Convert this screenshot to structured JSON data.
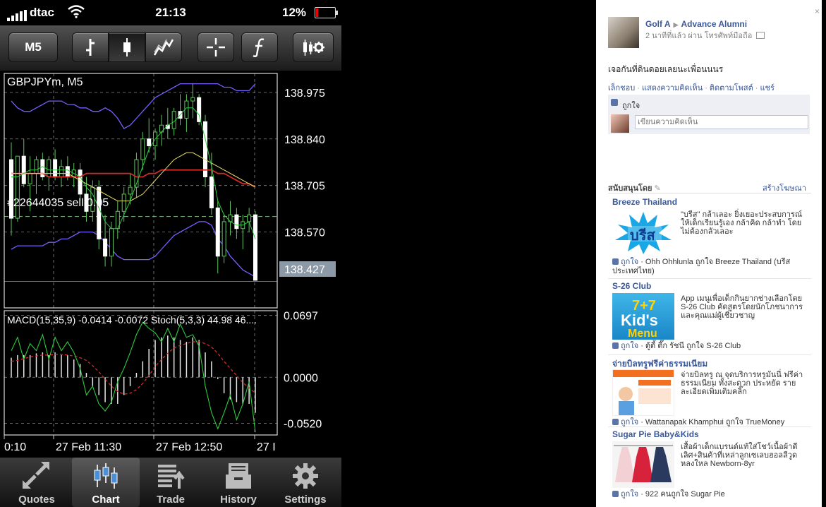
{
  "status": {
    "carrier": "dtac",
    "time": "21:13",
    "battery": "12%"
  },
  "toolbar": {
    "timeframe": "M5"
  },
  "chart": {
    "symbol_label": "GBPJPYm, M5",
    "order_label": "#22644035 sell 0.05",
    "indicator_label": "MACD(15,35,9) -0.0414 -0.0072 Stoch(5,3,3) 44.98 46....",
    "price_ticks": [
      "138.975",
      "138.840",
      "138.705",
      "138.570"
    ],
    "current_price": "138.427",
    "macd_ticks": [
      "0.0697",
      "0.0000",
      "-0.0520"
    ],
    "time_ticks": [
      "0:10",
      "27 Feb 11:30",
      "27 Feb 12:50",
      "27 I"
    ]
  },
  "chart_data": {
    "type": "candlestick",
    "price_ylim": [
      138.35,
      139.03
    ],
    "candles": [
      [
        138.78,
        138.83,
        138.56,
        138.61
      ],
      [
        138.61,
        138.79,
        138.6,
        138.79
      ],
      [
        138.79,
        138.84,
        138.7,
        138.71
      ],
      [
        138.71,
        138.79,
        138.63,
        138.74
      ],
      [
        138.74,
        138.79,
        138.68,
        138.78
      ],
      [
        138.78,
        138.8,
        138.72,
        138.73
      ],
      [
        138.73,
        138.79,
        138.69,
        138.78
      ],
      [
        138.78,
        138.81,
        138.72,
        138.73
      ],
      [
        138.73,
        138.78,
        138.7,
        138.76
      ],
      [
        138.76,
        138.79,
        138.72,
        138.73
      ],
      [
        138.73,
        138.77,
        138.7,
        138.75
      ],
      [
        138.75,
        138.77,
        138.66,
        138.68
      ],
      [
        138.68,
        138.73,
        138.6,
        138.63
      ],
      [
        138.63,
        138.72,
        138.6,
        138.7
      ],
      [
        138.7,
        138.72,
        138.52,
        138.55
      ],
      [
        138.55,
        138.62,
        138.47,
        138.5
      ],
      [
        138.5,
        138.6,
        138.47,
        138.58
      ],
      [
        138.58,
        138.66,
        138.55,
        138.63
      ],
      [
        138.63,
        138.7,
        138.6,
        138.68
      ],
      [
        138.68,
        138.74,
        138.65,
        138.7
      ],
      [
        138.7,
        138.8,
        138.67,
        138.78
      ],
      [
        138.78,
        138.86,
        138.75,
        138.84
      ],
      [
        138.84,
        138.9,
        138.8,
        138.82
      ],
      [
        138.82,
        138.87,
        138.78,
        138.86
      ],
      [
        138.86,
        138.91,
        138.82,
        138.88
      ],
      [
        138.88,
        138.93,
        138.84,
        138.87
      ],
      [
        138.87,
        138.93,
        138.85,
        138.92
      ],
      [
        138.92,
        138.97,
        138.88,
        138.9
      ],
      [
        138.9,
        138.97,
        138.86,
        138.95
      ],
      [
        138.95,
        139.0,
        138.9,
        138.96
      ],
      [
        138.96,
        138.97,
        138.88,
        138.89
      ],
      [
        138.89,
        138.91,
        138.7,
        138.73
      ],
      [
        138.73,
        138.8,
        138.62,
        138.64
      ],
      [
        138.64,
        138.66,
        138.45,
        138.5
      ],
      [
        138.5,
        138.62,
        138.48,
        138.6
      ],
      [
        138.6,
        138.66,
        138.56,
        138.62
      ],
      [
        138.62,
        138.64,
        138.55,
        138.58
      ],
      [
        138.58,
        138.62,
        138.52,
        138.6
      ],
      [
        138.6,
        138.64,
        138.57,
        138.62
      ],
      [
        138.62,
        138.63,
        138.43,
        138.43
      ]
    ],
    "upper_band": [
      138.95,
      138.93,
      138.92,
      138.92,
      138.93,
      138.94,
      138.95,
      138.95,
      138.95,
      138.94,
      138.94,
      138.93,
      138.93,
      138.92,
      138.92,
      138.93,
      138.92,
      138.9,
      138.87,
      138.88,
      138.9,
      138.92,
      138.94,
      138.96,
      138.97,
      138.98,
      138.99,
      139.0,
      139.0,
      139.0,
      139.0,
      139.0,
      139.0,
      139.0,
      138.99,
      138.99,
      138.98,
      138.98,
      138.98,
      139.0
    ],
    "lower_band": [
      138.52,
      138.53,
      138.53,
      138.53,
      138.53,
      138.53,
      138.54,
      138.54,
      138.55,
      138.55,
      138.56,
      138.57,
      138.57,
      138.57,
      138.56,
      138.54,
      138.52,
      138.5,
      138.49,
      138.49,
      138.49,
      138.49,
      138.49,
      138.5,
      138.52,
      138.54,
      138.56,
      138.57,
      138.58,
      138.59,
      138.6,
      138.6,
      138.59,
      138.55,
      138.53,
      138.5,
      138.48,
      138.46,
      138.45,
      138.44
    ],
    "ma_red": [
      138.74,
      138.74,
      138.74,
      138.74,
      138.74,
      138.74,
      138.73,
      138.73,
      138.73,
      138.73,
      138.73,
      138.73,
      138.74,
      138.74,
      138.74,
      138.74,
      138.74,
      138.74,
      138.74,
      138.74,
      138.73,
      138.73,
      138.74,
      138.74,
      138.75,
      138.75,
      138.75,
      138.75,
      138.75,
      138.75,
      138.75,
      138.75,
      138.75,
      138.74,
      138.74,
      138.73,
      138.72,
      138.71,
      138.71,
      138.7
    ],
    "ma_yellow": [
      138.74,
      138.74,
      138.74,
      138.74,
      138.74,
      138.74,
      138.74,
      138.74,
      138.74,
      138.74,
      138.73,
      138.72,
      138.71,
      138.7,
      138.69,
      138.68,
      138.67,
      138.66,
      138.66,
      138.66,
      138.67,
      138.68,
      138.7,
      138.72,
      138.74,
      138.76,
      138.78,
      138.79,
      138.8,
      138.8,
      138.79,
      138.78,
      138.77,
      138.76,
      138.75,
      138.74,
      138.73,
      138.72,
      138.71,
      138.7
    ],
    "ma_green": [
      138.73,
      138.73,
      138.74,
      138.75,
      138.75,
      138.76,
      138.75,
      138.75,
      138.75,
      138.75,
      138.74,
      138.73,
      138.7,
      138.68,
      138.64,
      138.6,
      138.58,
      138.58,
      138.62,
      138.66,
      138.71,
      138.76,
      138.81,
      138.84,
      138.86,
      138.88,
      138.89,
      138.91,
      138.93,
      138.93,
      138.91,
      138.84,
      138.76,
      138.66,
      138.62,
      138.6,
      138.59,
      138.59,
      138.6,
      138.55
    ],
    "macd_ylim": [
      -0.065,
      0.075
    ],
    "macd_hist": [
      0.022,
      0.025,
      0.025,
      0.025,
      0.027,
      0.028,
      0.025,
      0.028,
      0.025,
      0.025,
      0.02,
      0.015,
      0.005,
      -0.01,
      -0.02,
      -0.028,
      -0.03,
      -0.03,
      -0.02,
      -0.01,
      0.005,
      0.018,
      0.032,
      0.042,
      0.045,
      0.047,
      0.045,
      0.042,
      0.04,
      0.045,
      0.042,
      0.028,
      0.018,
      -0.002,
      -0.018,
      -0.025,
      -0.028,
      -0.03,
      -0.03,
      -0.04
    ],
    "macd_signal": [
      0.018,
      0.019,
      0.021,
      0.023,
      0.024,
      0.025,
      0.025,
      0.026,
      0.026,
      0.025,
      0.024,
      0.022,
      0.019,
      0.013,
      0.006,
      -0.002,
      -0.01,
      -0.016,
      -0.019,
      -0.018,
      -0.014,
      -0.007,
      0.002,
      0.012,
      0.02,
      0.027,
      0.033,
      0.036,
      0.038,
      0.04,
      0.04,
      0.038,
      0.034,
      0.027,
      0.018,
      0.01,
      0.002,
      -0.006,
      -0.012,
      -0.018
    ],
    "stoch_main": [
      0.03,
      0.045,
      0.02,
      0.038,
      0.03,
      0.048,
      0.02,
      0.045,
      0.03,
      0.04,
      0.028,
      0.01,
      -0.02,
      -0.01,
      -0.03,
      -0.038,
      -0.028,
      -0.005,
      0.01,
      0.028,
      0.048,
      0.062,
      0.055,
      0.05,
      0.04,
      0.055,
      0.04,
      0.06,
      0.045,
      0.048,
      0.035,
      -0.01,
      -0.04,
      -0.058,
      -0.04,
      -0.02,
      -0.048,
      -0.03,
      -0.005,
      -0.062
    ]
  },
  "bottom_tabs": [
    "Quotes",
    "Chart",
    "Trade",
    "History",
    "Settings"
  ],
  "facebook": {
    "close": "×",
    "author": "Golf A",
    "target": "Advance Alumni",
    "meta": "2 นาทีที่แล้ว ผ่าน โทรศัพท์มือถือ",
    "post": "เจอกันที่ดินดอยเลยนะเพื่อนนนร",
    "actions": [
      "เล็กชอบ",
      "แสดงความคิดเห็น",
      "ติดตามโพสต์",
      "แชร์"
    ],
    "likes": "ถูกใจ",
    "comment_placeholder": "เขียนความคิดเห็น",
    "sponsored": "สนับสนุนโดย",
    "create_ad": "สร้างโฆษณา",
    "ads": [
      {
        "title": "Breeze Thailand",
        "desc": "\"บรีส\" กล้าเลอะ ยิ่งเยอะประสบการณ์ ให้เด็กเรียนรู้เอง กล้าคิด กล้าทำ โดยไม่ต้องกลัวเลอะ",
        "like": "ถูกใจ",
        "social": " · Ohh Ohhlunla ถูกใจ Breeze Thailand (บรีส ประเทศไทย)"
      },
      {
        "title": "S-26 Club",
        "desc": "App เมนูเพื่อเด็กกินยากช่างเลือกโดย S-26 Club คัดสูตรโดยนักโภชนาการ และคุณแม่ผู้เชี่ยวชาญ",
        "like": "ถูกใจ",
        "social": " · ตู้ตี้ ตี๊ก รัชนี ถูกใจ S-26 Club"
      },
      {
        "title": "จ่ายบิลทรูฟรีค่าธรรมเนียม",
        "desc": "จ่ายบิลทรู ณ จุดบริการทรูมันนี่ ฟรีค่าธรรมเนียม ทั้งสะดวก ประหยัด รายละเอียดเพิ่มเติมคลิ๊ก",
        "like": "ถูกใจ",
        "social": " · Wattanapak Khamphui ถูกใจ TrueMoney"
      },
      {
        "title": "Sugar Pie Baby&Kids",
        "desc": "เสื้อผ้าเด็กแบรนด์แท้ใส่โชว์เนื้อผ้าดีเลิศ+สินค้าที่เหล่าลูกเซเลบฮอลลีวูดหลงใหล Newborn-8yr",
        "like": "ถูกใจ",
        "social": " · 922 คนถูกใจ Sugar Pie"
      }
    ],
    "ad_images": {
      "breeze_logo": "บรีส",
      "s26_top": "7+7",
      "s26_main": "Kid's",
      "s26_sub": "Menu"
    }
  }
}
